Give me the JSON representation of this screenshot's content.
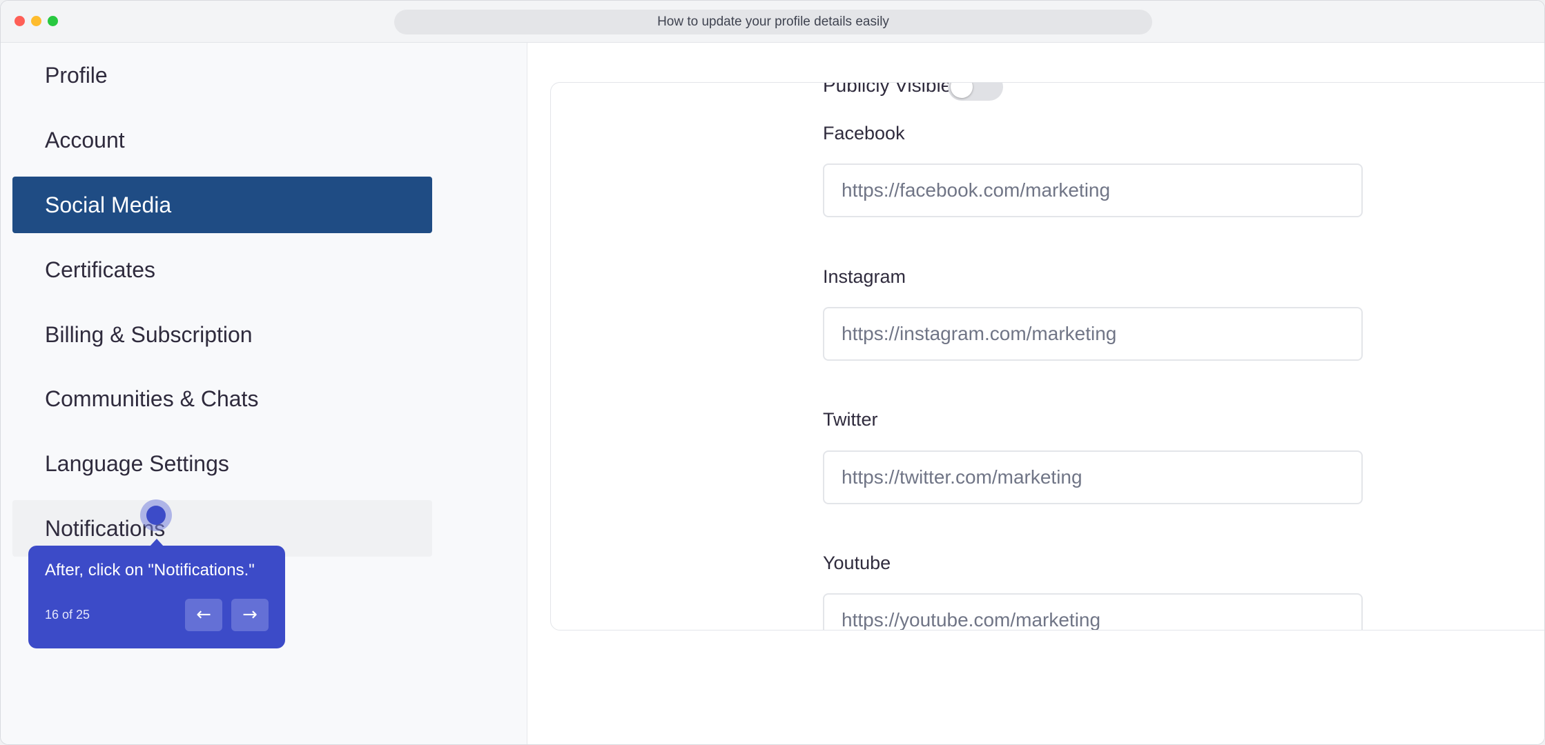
{
  "window": {
    "title": "How to update your profile details easily"
  },
  "sidebar": {
    "items": [
      {
        "label": "Profile"
      },
      {
        "label": "Account"
      },
      {
        "label": "Social Media"
      },
      {
        "label": "Certificates"
      },
      {
        "label": "Billing & Subscription"
      },
      {
        "label": "Communities & Chats"
      },
      {
        "label": "Language Settings"
      },
      {
        "label": "Notifications"
      }
    ],
    "active_item": "Social Media",
    "highlighted_item": "Notifications"
  },
  "tooltip": {
    "text": "After, click on \"Notifications.\"",
    "step": "16 of 25",
    "prev_icon": "arrow-left-icon",
    "next_icon": "arrow-right-icon",
    "prev_glyph": "←",
    "next_glyph": "→"
  },
  "social": {
    "visibility_label": "Publicly Visible",
    "visibility_on": false,
    "fields": [
      {
        "label": "Facebook",
        "value": "https://facebook.com/marketing"
      },
      {
        "label": "Instagram",
        "value": "https://instagram.com/marketing"
      },
      {
        "label": "Twitter",
        "value": "https://twitter.com/marketing"
      },
      {
        "label": "Youtube",
        "value": "https://youtube.com/marketing"
      }
    ]
  },
  "colors": {
    "active_nav": "#1f4c84",
    "tooltip_bg": "#3c4bc8"
  }
}
